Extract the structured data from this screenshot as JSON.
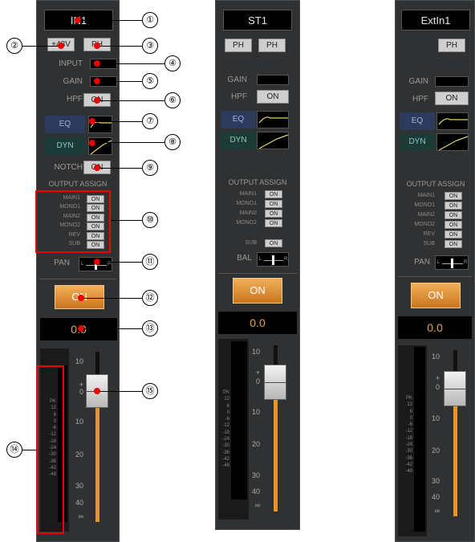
{
  "strips": [
    {
      "name": "IN1",
      "btn_a": "+48V",
      "btn_b": "PH",
      "input_label": "INPUT",
      "gain_label": "GAIN",
      "hpf_label": "HPF",
      "hpf_state": "ON",
      "eq": "EQ",
      "dyn": "DYN",
      "notch_label": "NOTCH",
      "notch_state": "ON",
      "output_assign": "OUTPUT ASSIGN",
      "pan_label": "PAN",
      "on": "ON",
      "level": "0.0"
    },
    {
      "name": "ST1",
      "btn_a": "PH",
      "btn_b": "PH",
      "gain_label": "GAIN",
      "hpf_label": "HPF",
      "hpf_state": "ON",
      "eq": "EQ",
      "dyn": "DYN",
      "output_assign": "OUTPUT ASSIGN",
      "sub_label": "SUB",
      "sub_state": "ON",
      "bal_label": "BAL",
      "on": "ON",
      "level": "0.0"
    },
    {
      "name": "ExtIn1",
      "btn_b": "PH",
      "gain_label": "GAIN",
      "hpf_label": "HPF",
      "hpf_state": "ON",
      "eq": "EQ",
      "dyn": "DYN",
      "output_assign": "OUTPUT ASSIGN",
      "pan_label": "PAN",
      "on": "ON",
      "level": "0.0"
    }
  ],
  "assign_rows": [
    {
      "label": "MAIN1",
      "state": "ON"
    },
    {
      "label": "MONO1",
      "state": "ON"
    },
    {
      "label": "MAIN2",
      "state": "ON"
    },
    {
      "label": "MONO2",
      "state": "ON"
    },
    {
      "label": "REV",
      "state": "ON"
    },
    {
      "label": "SUB",
      "state": "ON"
    }
  ],
  "st_assign_rows": [
    {
      "label": "MAIN1",
      "state": "ON"
    },
    {
      "label": "MONO1",
      "state": "ON"
    },
    {
      "label": "MAIN2",
      "state": "ON"
    },
    {
      "label": "MONO2",
      "state": "ON"
    }
  ],
  "pan_ends": {
    "l": "L",
    "r": "R"
  },
  "meter_scale": [
    "PK",
    "12",
    "6",
    "0",
    "-6",
    "-12",
    "-18",
    "-24",
    "-30",
    "-36",
    "-42",
    "-48"
  ],
  "fader_scale": [
    "10",
    "+",
    "0",
    "10",
    "20",
    "30",
    "40",
    "∞"
  ],
  "callouts": [
    "①",
    "②",
    "③",
    "④",
    "⑤",
    "⑥",
    "⑦",
    "⑧",
    "⑨",
    "⑩",
    "⑪",
    "⑫",
    "⑬",
    "⑭",
    "⑮"
  ],
  "colors": {
    "accent": "#e59624",
    "highlight": "#ee0000",
    "eq": "#2c3a5c",
    "dyn": "#1d3b36"
  }
}
